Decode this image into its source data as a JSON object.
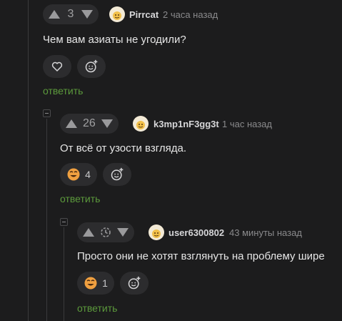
{
  "comments": [
    {
      "score": "3",
      "author": "Pirrcat",
      "time": "2 часа назад",
      "text": "Чем вам азиаты не угодили?",
      "reply_label": "ответить"
    },
    {
      "score": "26",
      "author": "k3mp1nF3gg3t",
      "time": "1 час назад",
      "text": "От всё от узости взгляда.",
      "reaction_count": "4",
      "reply_label": "ответить"
    },
    {
      "score_icon": "clock-icon",
      "author": "user6300802",
      "time": "43 минуты назад",
      "text": "Просто они не хотят взглянуть на проблему шире",
      "reaction_count": "1",
      "reply_label": "ответить"
    }
  ],
  "colors": {
    "background": "#1c1c1d",
    "pill": "#2c2c2e",
    "reply_link": "#5c9a3c",
    "avatar_bg": "#f3ead6",
    "reaction_face": "#f0a040"
  }
}
